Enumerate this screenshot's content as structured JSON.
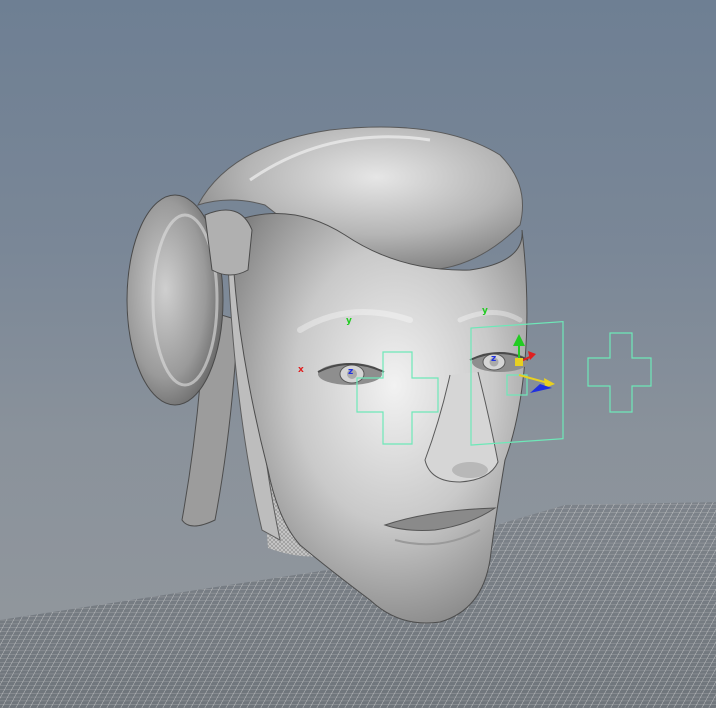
{
  "viewport": {
    "object": "head",
    "colors": {
      "background_top": "#6e7f93",
      "background_bottom": "#93989d",
      "selection": "#6ee8b8",
      "axis_x": "#e02020",
      "axis_y": "#22cc22",
      "axis_z": "#2030e0",
      "mesh": "#a9a9a9",
      "grid": "#cfcfcf"
    },
    "icons": {
      "move_manipulator": "move-manipulator-icon",
      "axis_x_marker": "x-marker-icon",
      "axis_y_marker": "y-marker-icon"
    },
    "markers": {
      "left_eye_y": "y",
      "left_eye_x": "x",
      "right_eye_y": "y"
    }
  }
}
